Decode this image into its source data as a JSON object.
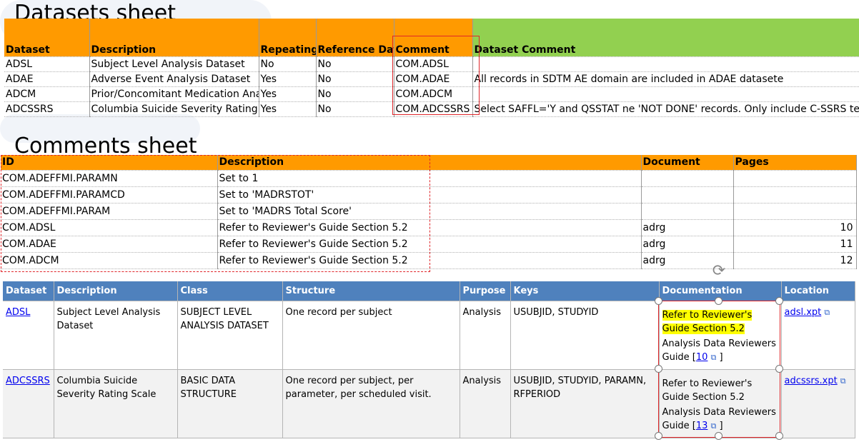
{
  "datasets_sheet": {
    "title": "Datasets sheet",
    "headers": [
      "Dataset",
      "Description",
      "Repeating",
      "Reference Data",
      "Comment",
      "Dataset Comment"
    ],
    "rows": [
      [
        "ADSL",
        "Subject Level Analysis Dataset",
        "No",
        "No",
        "COM.ADSL",
        ""
      ],
      [
        "ADAE",
        "Adverse Event Analysis Dataset",
        "Yes",
        "No",
        "COM.ADAE",
        "All records in SDTM AE domain are included in ADAE datasete"
      ],
      [
        "ADCM",
        "Prior/Concomitant Medication Anal",
        "Yes",
        "No",
        "COM.ADCM",
        ""
      ],
      [
        "ADCSSRS",
        "Columbia Suicide Severity Rating Sc",
        "Yes",
        "No",
        "COM.ADCSSRS",
        "Select SAFFL='Y and QSSTAT ne 'NOT DONE' records. Only include C-SSRS test."
      ]
    ]
  },
  "comments_sheet": {
    "title": "Comments sheet",
    "headers": [
      "ID",
      "Description",
      "Document",
      "Pages"
    ],
    "rows": [
      [
        "COM.ADEFFMI.PARAMN",
        "Set to 1",
        "",
        ""
      ],
      [
        "COM.ADEFFMI.PARAMCD",
        "Set to 'MADRSTOT'",
        "",
        ""
      ],
      [
        "COM.ADEFFMI.PARAM",
        "Set to 'MADRS Total Score'",
        "",
        ""
      ],
      [
        "COM.ADSL",
        "Refer to Reviewer's Guide Section 5.2",
        "adrg",
        "10"
      ],
      [
        "COM.ADAE",
        "Refer to Reviewer's Guide Section 5.2",
        "adrg",
        "11"
      ],
      [
        "COM.ADCM",
        "Refer to Reviewer's Guide Section 5.2",
        "adrg",
        "12"
      ]
    ]
  },
  "define_table": {
    "headers": [
      "Dataset",
      "Description",
      "Class",
      "Structure",
      "Purpose",
      "Keys",
      "Documentation",
      "Location"
    ],
    "rows": [
      {
        "dataset": "ADSL",
        "description": "Subject Level Analysis Dataset",
        "class": "SUBJECT LEVEL ANALYSIS DATASET",
        "structure": "One record per subject",
        "purpose": "Analysis",
        "keys": "USUBJID, STUDYID",
        "doc_text": "Refer to Reviewer's Guide Section 5.2",
        "doc_ref_prefix": "Analysis Data Reviewers Guide [",
        "doc_page": "10",
        "doc_ref_suffix": "]",
        "location": "adsl.xpt"
      },
      {
        "dataset": "ADCSSRS",
        "description": "Columbia Suicide Severity Rating Scale",
        "class": "BASIC DATA STRUCTURE",
        "structure": "One record per subject, per parameter, per scheduled visit.",
        "purpose": "Analysis",
        "keys": "USUBJID, STUDYID, PARAMN, RFPERIOD",
        "doc_text": "Refer to Reviewer's Guide Section 5.2",
        "doc_ref_prefix": "Analysis Data Reviewers Guide [",
        "doc_page": "13",
        "doc_ref_suffix": "]",
        "location": "adcssrs.xpt"
      }
    ]
  },
  "icons": {
    "external_link": "external-link-icon",
    "rotate": "rotate-handle-icon"
  },
  "colors": {
    "orange_header": "#ff9a00",
    "green_header": "#92d050",
    "blue_header": "#4f81bd",
    "highlight": "#ffff00",
    "callout_red": "#e0262a",
    "link": "#0000ee"
  }
}
